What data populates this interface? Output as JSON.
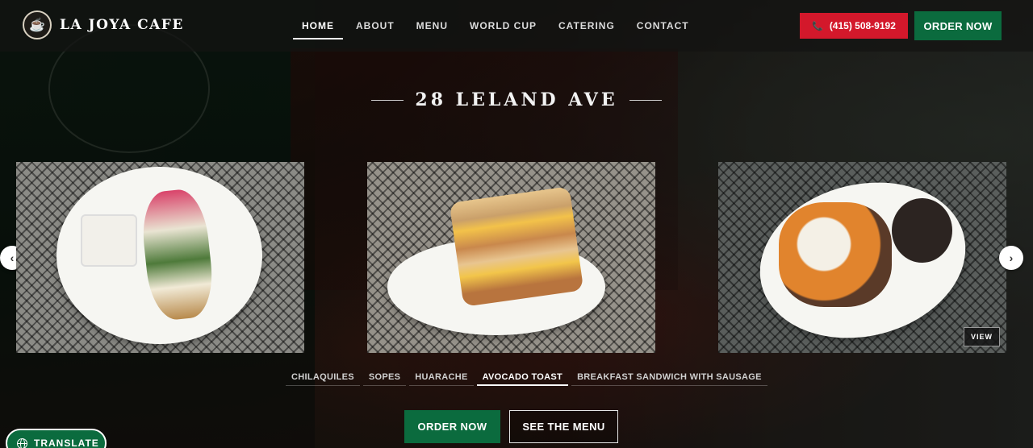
{
  "header": {
    "brand_name": "LA JOYA CAFE",
    "brand_logo_icon": "coffee-cup-icon",
    "nav": [
      "HOME",
      "ABOUT",
      "MENU",
      "WORLD CUP",
      "CATERING",
      "CONTACT"
    ],
    "active_nav": "HOME",
    "phone_label": "(415) 508-9192",
    "phone_icon": "phone-icon",
    "order_label": "ORDER NOW"
  },
  "hero": {
    "location_title": "28 LELAND AVE",
    "cards": [
      {
        "alt_name": "avocado-toast-photo"
      },
      {
        "alt_name": "breakfast-sandwich-photo"
      },
      {
        "alt_name": "chilaquiles-photo"
      }
    ],
    "view_label": "VIEW",
    "arrow_left_icon": "chevron-left-icon",
    "arrow_right_icon": "chevron-right-icon",
    "tabs": [
      "CHILAQUILES",
      "SOPES",
      "HUARACHE",
      "AVOCADO TOAST",
      "BREAKFAST SANDWICH WITH SAUSAGE"
    ],
    "active_tab": "AVOCADO TOAST",
    "order_label": "ORDER NOW",
    "menu_label": "SEE THE MENU"
  },
  "translate": {
    "label": "TRANSLATE",
    "icon": "globe-icon"
  },
  "colors": {
    "green": "#0b6b3e",
    "red": "#d3182b"
  }
}
